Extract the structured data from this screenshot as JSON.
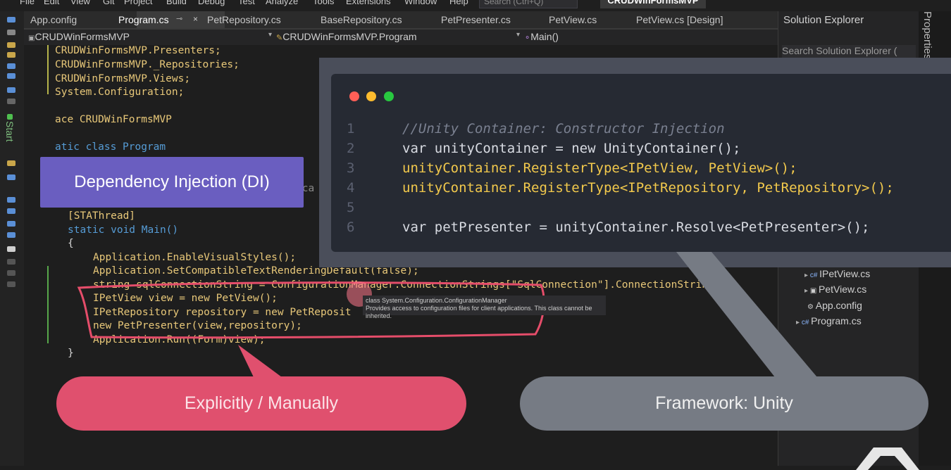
{
  "menu": {
    "items": [
      "File",
      "Edit",
      "View",
      "Git",
      "Project",
      "Build",
      "Debug",
      "Test",
      "Analyze",
      "Tools",
      "Extensions",
      "Window",
      "Help"
    ],
    "search_placeholder": "Search (Ctrl+Q)",
    "solution_name": "CRUDWinFormsMVP"
  },
  "tabs": [
    {
      "label": "App.config"
    },
    {
      "label": "Program.cs"
    },
    {
      "label": "PetRepository.cs"
    },
    {
      "label": "BaseRepository.cs"
    },
    {
      "label": "PetPresenter.cs"
    },
    {
      "label": "PetView.cs"
    },
    {
      "label": "PetView.cs [Design]"
    }
  ],
  "nav": {
    "project": "CRUDWinFormsMVP",
    "class": "CRUDWinFormsMVP.Program",
    "member": "Main()"
  },
  "code": {
    "using1": "CRUDWinFormsMVP.Presenters;",
    "using2": "CRUDWinFormsMVP._Repositories;",
    "using3": "CRUDWinFormsMVP.Views;",
    "using4": "System.Configuration;",
    "ns": "ace CRUDWinFormsMVP",
    "cls": "atic class Program",
    "attr": "[STAThread]",
    "main_sig": "static void Main()",
    "brace_open": "{",
    "l1": "Application.EnableVisualStyles();",
    "l2": "Application.SetCompatibleTextRenderingDefault(false);",
    "l3": "string sqlConnectionString = ConfigurationManager.ConnectionStrings[\"SqlConnection\"].ConnectionString;",
    "l4": "IPetView view = new PetView();",
    "l5": "IPetRepository repository = new PetReposit",
    "l6": "new PetPresenter(view,repository);",
    "l7": "Application.Run((Form)view);",
    "brace_close": "}",
    "partial": "ica"
  },
  "tooltip": {
    "title": "class System.Configuration.ConfigurationManager",
    "desc": "Provides access to configuration files for client applications. This class cannot be inherited."
  },
  "solution_explorer": {
    "title": "Solution Explorer",
    "search_placeholder": "Search Solution Explorer (",
    "items": [
      "IPetView.cs",
      "PetView.cs",
      "App.config",
      "Program.cs"
    ],
    "properties_label": "Properties"
  },
  "overlay": {
    "line_numbers": [
      "1",
      "2",
      "3",
      "4",
      "5",
      "6"
    ],
    "comment": "//Unity Container: Constructor Injection",
    "line2": "var unityContainer = new UnityContainer();",
    "line3": "unityContainer.RegisterType<IPetView, PetView>();",
    "line4": "unityContainer.RegisterType<IPetRepository, PetRepository>();",
    "line6": "var petPresenter = unityContainer.Resolve<PetPresenter>();"
  },
  "labels": {
    "di": "Dependency Injection (DI)",
    "explicit": "Explicitly / Manually",
    "framework": "Framework: Unity"
  },
  "toolbar": {
    "start": "Start"
  },
  "colors": {
    "accent_pink": "#e0506e",
    "accent_purple": "#6a5ec0",
    "gray_pill": "#767b84",
    "highlight_box": "#e54d6a"
  }
}
